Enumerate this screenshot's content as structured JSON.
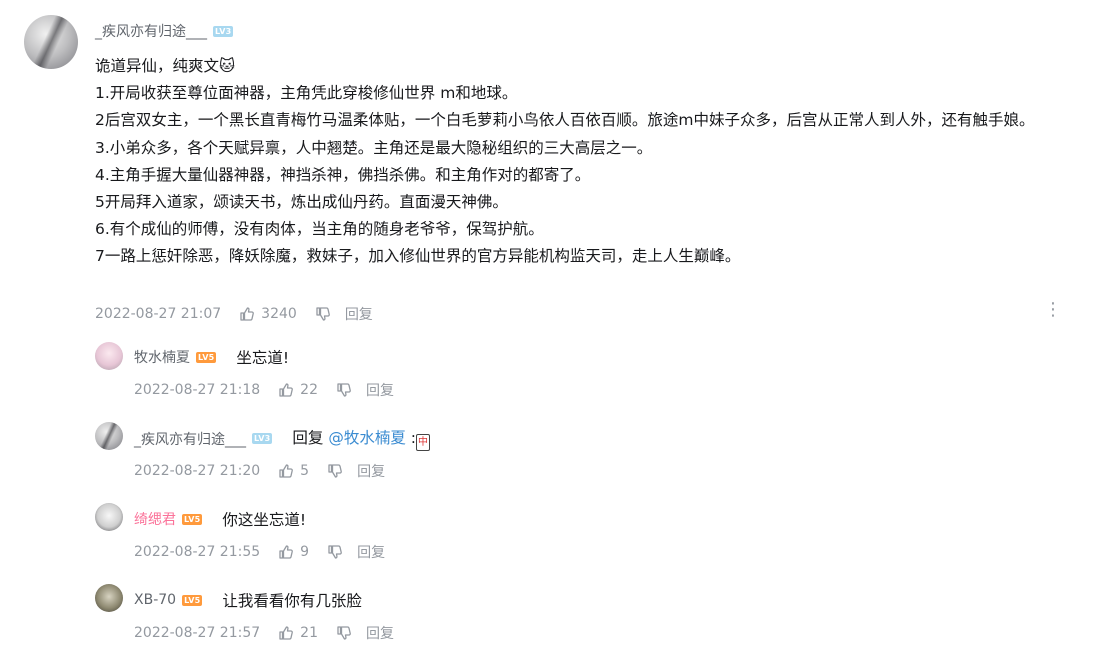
{
  "main_comment": {
    "username": "_疾风亦有归途___",
    "level": "LV3",
    "lines": [
      "诡道异仙，纯爽文🐱",
      "1.开局收获至尊位面神器，主角凭此穿梭修仙世界 m和地球。",
      "2后宫双女主，一个黑长直青梅竹马温柔体贴，一个白毛萝莉小鸟依人百依百顺。旅途m中妹子众多，后宫从正常人到人外，还有触手娘。",
      "3.小弟众多，各个天赋异禀，人中翘楚。主角还是最大隐秘组织的三大高层之一。",
      "4.主角手握大量仙器神器，神挡杀神，佛挡杀佛。和主角作对的都寄了。",
      "5开局拜入道家，颂读天书，炼出成仙丹药。直面漫天神佛。",
      "6.有个成仙的师傅，没有肉体，当主角的随身老爷爷，保驾护航。",
      "7一路上惩奸除恶，降妖除魔，救妹子，加入修仙世界的官方异能机构监天司，走上人生巅峰。"
    ],
    "time": "2022-08-27 21:07",
    "likes": "3240",
    "reply_label": "回复"
  },
  "replies": [
    {
      "username": "牧水楠夏",
      "level": "LV5",
      "text": "坐忘道!",
      "time": "2022-08-27 21:18",
      "likes": "22",
      "reply_label": "回复"
    },
    {
      "username": "_疾风亦有归途___",
      "level": "LV3",
      "prefix": "回复",
      "mention": "@牧水楠夏",
      "suffix": " :",
      "emoji": "中",
      "time": "2022-08-27 21:20",
      "likes": "5",
      "reply_label": "回复"
    },
    {
      "username": "绮缌君",
      "level": "LV5",
      "text": "你这坐忘道!",
      "time": "2022-08-27 21:55",
      "likes": "9",
      "reply_label": "回复"
    },
    {
      "username": "XB-70",
      "level": "LV5",
      "text": "让我看看你有几张脸",
      "time": "2022-08-27 21:57",
      "likes": "21",
      "reply_label": "回复"
    }
  ],
  "icons": {
    "like": "thumbs-up-icon",
    "dislike": "thumbs-down-icon",
    "more": "more-vertical-icon"
  },
  "colors": {
    "username": "#61666d",
    "username_vip": "#fb7299",
    "meta": "#9499a0",
    "mention": "#3a8bd1",
    "lv3": "#a8d8f0",
    "lv5": "#ff9a3c"
  }
}
